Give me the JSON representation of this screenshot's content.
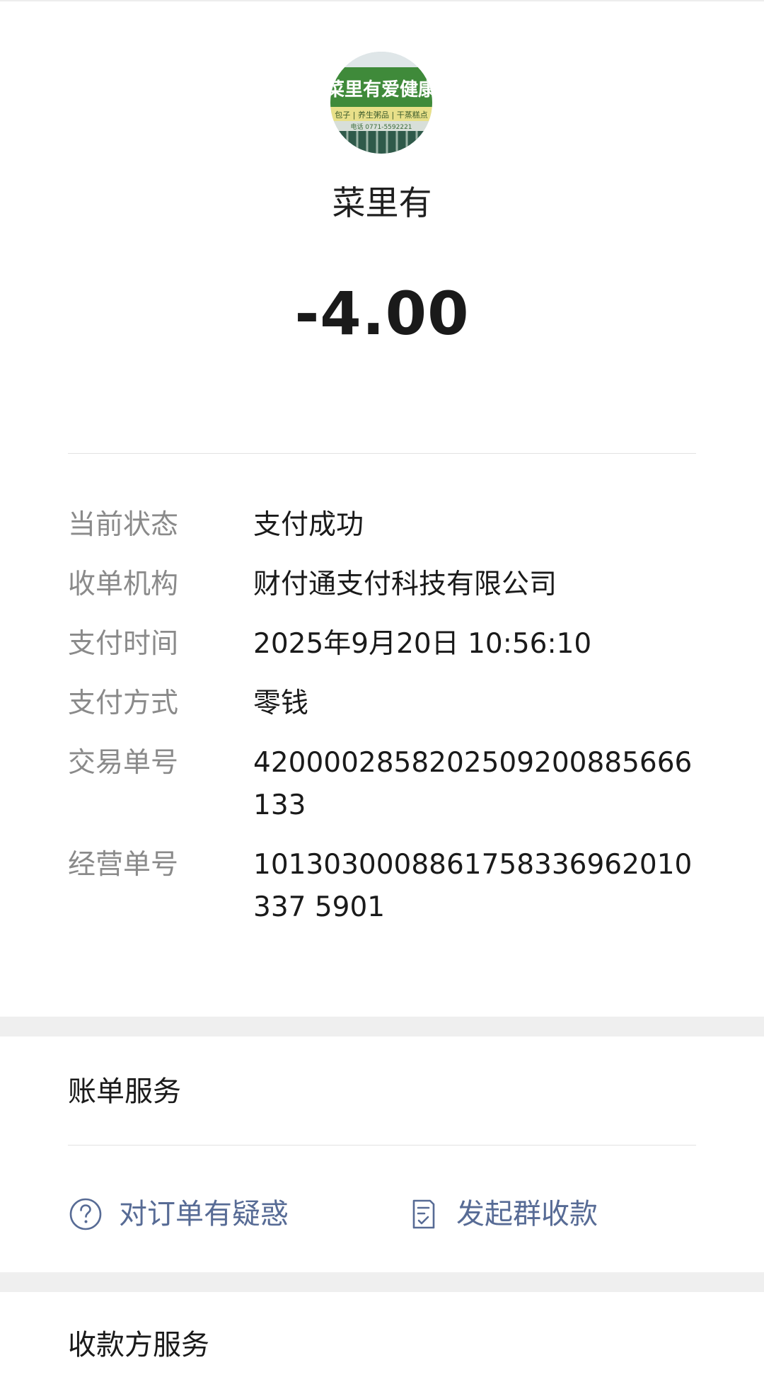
{
  "merchant": {
    "name": "菜里有",
    "avatar_sign_text": "菜里有爱健康",
    "avatar_sub_text": "包子 | 养生粥品 | 干蒸糕点",
    "avatar_phone": "电话 0771-5592221"
  },
  "amount": "-4.00",
  "details": [
    {
      "label": "当前状态",
      "value": "支付成功"
    },
    {
      "label": "收单机构",
      "value": "财付通支付科技有限公司"
    },
    {
      "label": "支付时间",
      "value": "2025年9月20日 10:56:10"
    },
    {
      "label": "支付方式",
      "value": "零钱"
    },
    {
      "label": "交易单号",
      "value": "4200002858202509200885666133"
    },
    {
      "label": "经营单号",
      "value": "1013030008861758336962010337 5901"
    }
  ],
  "bill_service": {
    "title": "账单服务",
    "question_label": "对订单有疑惑",
    "group_collect_label": "发起群收款"
  },
  "payee_service": {
    "title": "收款方服务"
  },
  "colors": {
    "link": "#576b95",
    "label_gray": "#8a8a8a",
    "section_gap": "#efefef"
  }
}
